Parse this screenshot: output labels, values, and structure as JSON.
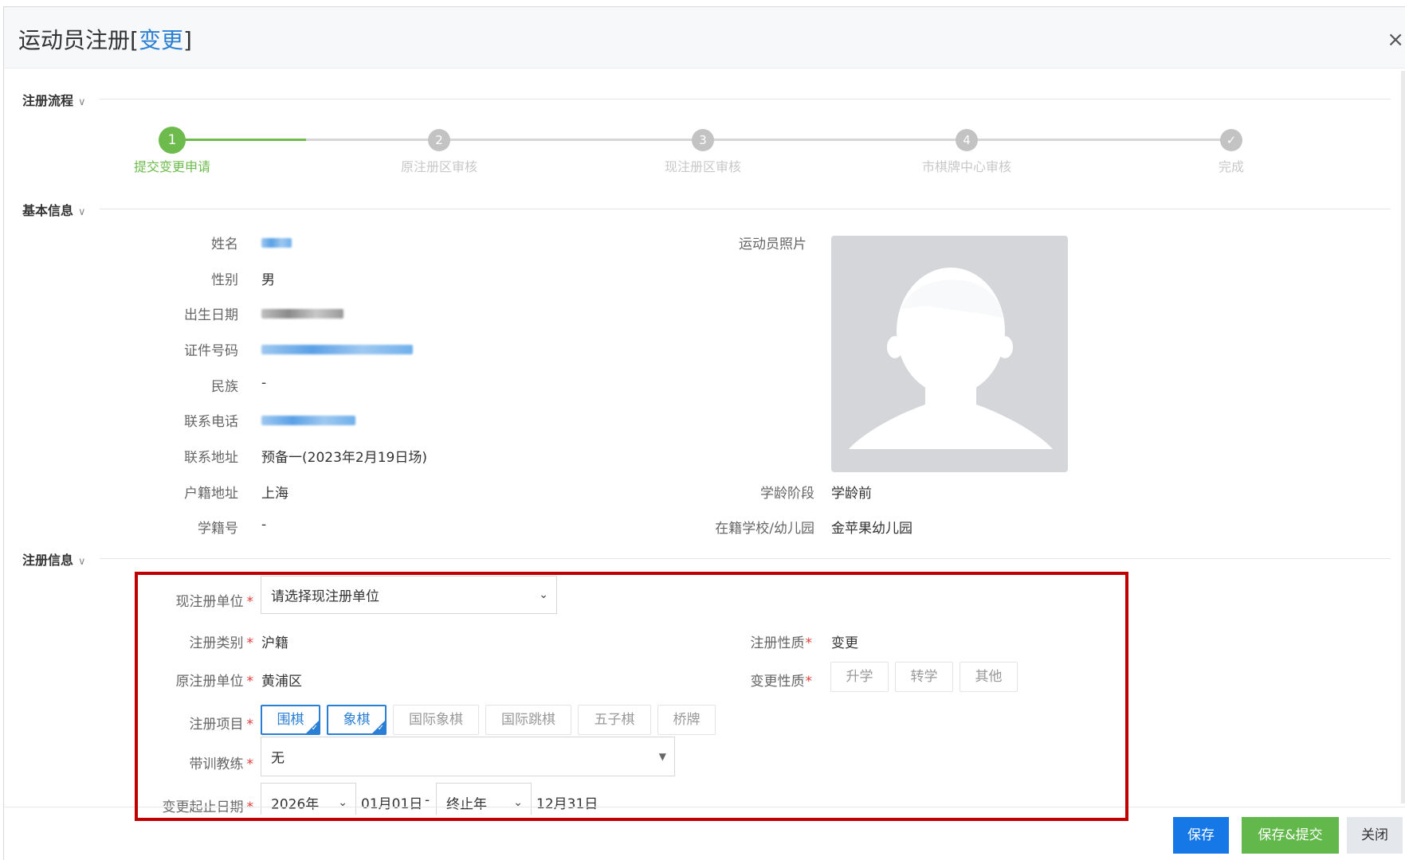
{
  "dialog": {
    "title_main": "运动员注册[",
    "title_accent": "变更",
    "title_end": "]",
    "close_icon": "×"
  },
  "sections": {
    "flow": "注册流程",
    "basic": "基本信息",
    "register": "注册信息",
    "chevron": "∨"
  },
  "steps": [
    {
      "index": "1",
      "label": "提交变更申请",
      "active": true
    },
    {
      "index": "2",
      "label": "原注册区审核",
      "active": false
    },
    {
      "index": "3",
      "label": "现注册区审核",
      "active": false
    },
    {
      "index": "4",
      "label": "市棋牌中心审核",
      "active": false
    },
    {
      "index": "✓",
      "label": "完成",
      "active": false
    }
  ],
  "basic": {
    "name_label": "姓名",
    "gender_label": "性别",
    "gender_value": "男",
    "birth_label": "出生日期",
    "id_label": "证件号码",
    "ethnicity_label": "民族",
    "ethnicity_value": "-",
    "phone_label": "联系电话",
    "address_label": "联系地址",
    "address_value": "预备一(2023年2月19日场)",
    "hukou_label": "户籍地址",
    "hukou_value": "上海",
    "student_no_label": "学籍号",
    "student_no_value": "-",
    "photo_label": "运动员照片",
    "school_stage_label": "学龄阶段",
    "school_stage_value": "学龄前",
    "school_label": "在籍学校/幼儿园",
    "school_value": "金苹果幼儿园"
  },
  "register": {
    "current_unit_label": "现注册单位",
    "current_unit_placeholder": "请选择现注册单位",
    "category_label": "注册类别",
    "category_value": "沪籍",
    "nature_label": "注册性质",
    "nature_value": "变更",
    "orig_unit_label": "原注册单位",
    "orig_unit_value": "黄浦区",
    "change_nature_label": "变更性质",
    "change_options": [
      "升学",
      "转学",
      "其他"
    ],
    "items_label": "注册项目",
    "items": [
      {
        "label": "围棋",
        "selected": true
      },
      {
        "label": "象棋",
        "selected": true
      },
      {
        "label": "国际象棋",
        "selected": false
      },
      {
        "label": "国际跳棋",
        "selected": false
      },
      {
        "label": "五子棋",
        "selected": false
      },
      {
        "label": "桥牌",
        "selected": false
      }
    ],
    "coach_label": "带训教练",
    "coach_value": "无",
    "date_label": "变更起止日期",
    "start_year": "2026年",
    "start_md": "01月01日",
    "dash": "-",
    "end_year": "终止年",
    "end_md": "12月31日",
    "required_mark": "*"
  },
  "footer": {
    "save": "保存",
    "save_submit": "保存&提交",
    "close": "关闭"
  },
  "colors": {
    "accent_blue": "#2a7fd4",
    "step_green": "#6dbb4c",
    "save_blue": "#1677e6",
    "submit_green": "#62b84a",
    "highlight_red": "#c00000"
  }
}
